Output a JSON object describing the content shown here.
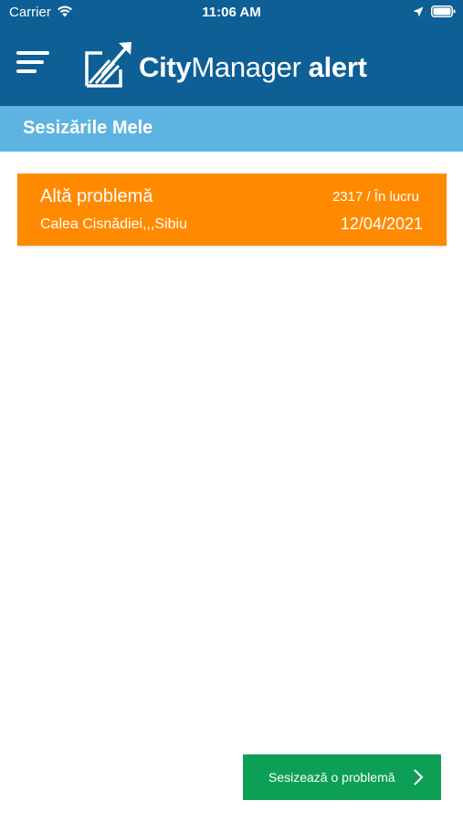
{
  "status_bar": {
    "carrier": "Carrier",
    "time": "11:06 AM",
    "icons": [
      "wifi-icon",
      "location-arrow-icon",
      "battery-icon"
    ]
  },
  "nav_bar": {
    "menu_icon": "hamburger-menu-icon",
    "logo": {
      "city": "City",
      "manager": "Manager",
      "alert": "alert"
    }
  },
  "section": {
    "title": "Sesizările Mele"
  },
  "reports": [
    {
      "category": "Altă problemă",
      "status": "2317 / În lucru",
      "address": "Calea Cisnădiei,,,Sibiu",
      "date": "12/04/2021"
    }
  ],
  "actions": {
    "report_problem_label": "Sesizează o problemă",
    "report_problem_icon": "chevron-right-icon"
  },
  "colors": {
    "header_blue": "#0D5F96",
    "section_blue": "#5DB3E1",
    "report_orange": "#FF8A00",
    "action_green": "#0E9F57"
  }
}
